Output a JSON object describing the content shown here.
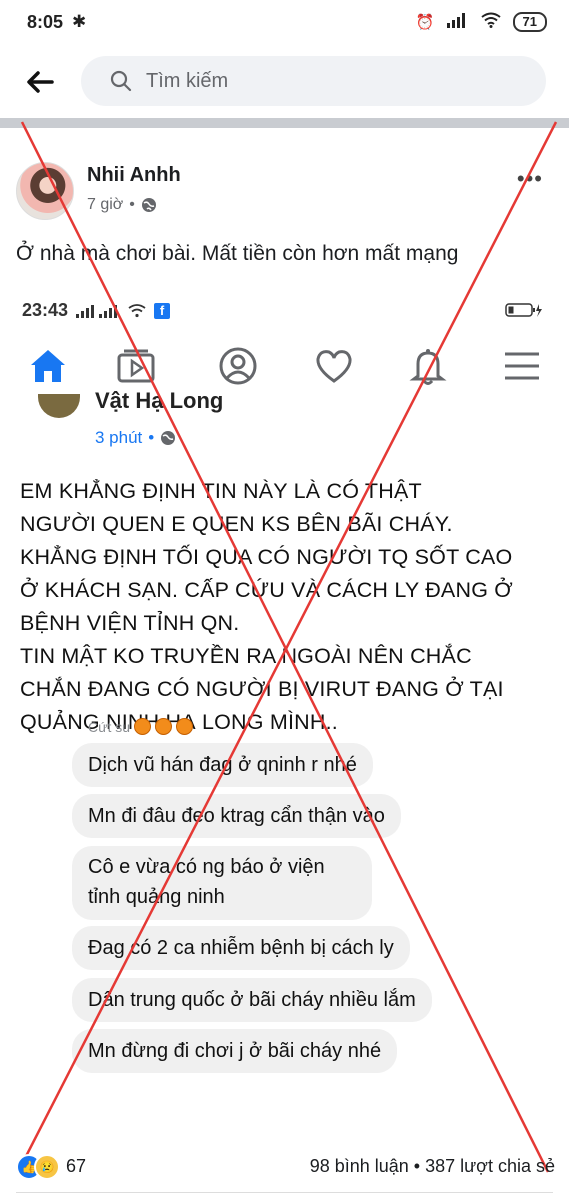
{
  "status_bar": {
    "time": "8:05",
    "battery": "71"
  },
  "search": {
    "placeholder": "Tìm kiếm"
  },
  "post": {
    "author": "Nhii Anhh",
    "time": "7 giờ",
    "separator": "•",
    "text": "Ở nhà mà chơi bài. Mất tiền còn hơn mất mạng"
  },
  "embedded_screenshot": {
    "time": "23:43",
    "author": "Vật Hạ Long",
    "post_time": "3 phút",
    "separator": "•",
    "body_lines": [
      "EM KHẲNG ĐỊNH TIN NÀY LÀ CÓ THẬT",
      "NGƯỜI QUEN E QUEN KS BÊN BÃI CHÁY.",
      "KHẲNG ĐỊNH TỐI QUA CÓ NGƯỜI TQ SỐT CAO",
      "Ở KHÁCH SẠN. CẤP CỨU VÀ CÁCH LY ĐANG Ở",
      "BỆNH VIỆN TỈNH QN.",
      "TIN MẬT KO TRUYỀN RA NGOÀI NÊN CHẮC",
      "CHẮN ĐANG CÓ NGƯỜI BỊ VIRUT ĐANG Ở TẠI",
      "QUẢNG NINH HẠ LONG MÌNH.."
    ],
    "chat_sender": "Cứt su",
    "messages": [
      "Dịch vũ hán đag ở qninh r nhé",
      "Mn đi đâu đeo ktrag cẩn thận vào",
      "Cô e vừa có ng báo ở viện tỉnh quảng ninh",
      "Đag có 2 ca nhiễm bệnh bị cách ly",
      "Dân trung quốc ở bãi cháy nhiều lắm",
      "Mn đừng đi chơi j ở bãi cháy nhé"
    ]
  },
  "reactions": {
    "count": "67",
    "comments_shares": "98 bình luận • 387 lượt chia sẻ"
  },
  "colors": {
    "cross": "#e53935",
    "brand": "#1877f2"
  }
}
